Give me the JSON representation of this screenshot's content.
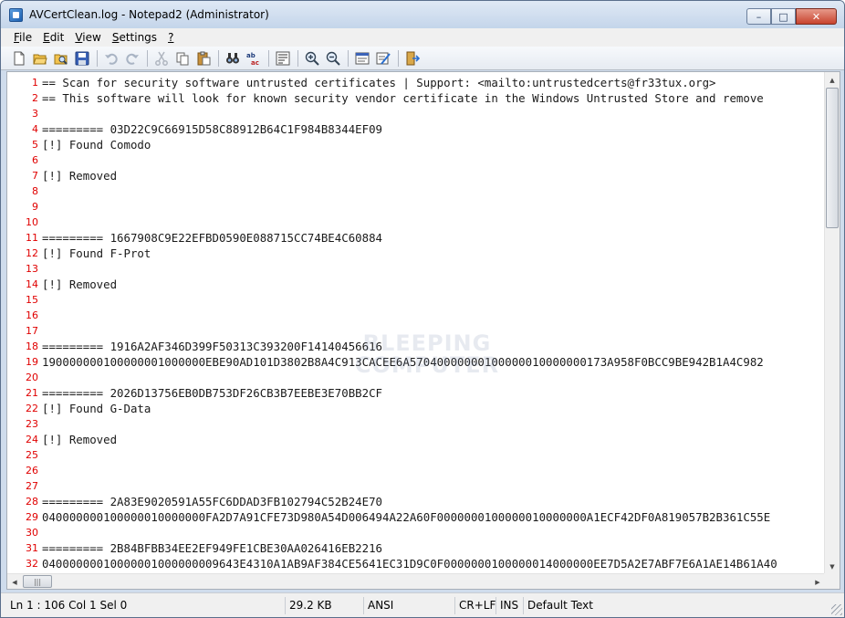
{
  "window": {
    "title": "AVCertClean.log - Notepad2 (Administrator)",
    "minimize_glyph": "–",
    "maximize_glyph": "□",
    "close_glyph": "✕"
  },
  "menu": {
    "file": {
      "accel": "F",
      "rest": "ile"
    },
    "edit": {
      "accel": "E",
      "rest": "dit"
    },
    "view": {
      "accel": "V",
      "rest": "iew"
    },
    "settings": {
      "accel": "S",
      "rest": "ettings"
    },
    "help": {
      "accel": "?",
      "rest": ""
    }
  },
  "toolbar_icons": [
    "new-file-icon",
    "open-folder-icon",
    "browse-icon",
    "save-icon",
    "undo-icon",
    "redo-icon",
    "cut-icon",
    "copy-icon",
    "paste-icon",
    "find-icon",
    "replace-icon",
    "word-wrap-icon",
    "zoom-in-icon",
    "zoom-out-icon",
    "schemes-icon",
    "customize-schemes-icon",
    "exit-icon"
  ],
  "watermark": {
    "line1": "BLEEPING",
    "line2": "COMPUTER"
  },
  "editor": {
    "lines": [
      {
        "n": "1",
        "text": "== Scan for security software untrusted certificates | Support: <mailto:untrustedcerts@fr33tux.org>"
      },
      {
        "n": "2",
        "text": "== This software will look for known security vendor certificate in the Windows Untrusted Store and remove"
      },
      {
        "n": "3",
        "text": ""
      },
      {
        "n": "4",
        "text": "========= 03D22C9C66915D58C88912B64C1F984B8344EF09"
      },
      {
        "n": "5",
        "text": "[!] Found Comodo"
      },
      {
        "n": "6",
        "text": ""
      },
      {
        "n": "7",
        "text": "[!] Removed"
      },
      {
        "n": "8",
        "text": ""
      },
      {
        "n": "9",
        "text": ""
      },
      {
        "n": "10",
        "text": ""
      },
      {
        "n": "11",
        "text": "========= 1667908C9E22EFBD0590E088715CC74BE4C60884"
      },
      {
        "n": "12",
        "text": "[!] Found F-Prot"
      },
      {
        "n": "13",
        "text": ""
      },
      {
        "n": "14",
        "text": "[!] Removed"
      },
      {
        "n": "15",
        "text": ""
      },
      {
        "n": "16",
        "text": ""
      },
      {
        "n": "17",
        "text": ""
      },
      {
        "n": "18",
        "text": "========= 1916A2AF346D399F50313C393200F14140456616"
      },
      {
        "n": "19",
        "text": "190000000100000001000000EBE90AD101D3802B8A4C913CACEE6A57040000000100000010000000173A958F0BCC9BE942B1A4C982"
      },
      {
        "n": "20",
        "text": ""
      },
      {
        "n": "21",
        "text": "========= 2026D13756EB0DB753DF26CB3B7EEBE3E70BB2CF"
      },
      {
        "n": "22",
        "text": "[!] Found G-Data"
      },
      {
        "n": "23",
        "text": ""
      },
      {
        "n": "24",
        "text": "[!] Removed"
      },
      {
        "n": "25",
        "text": ""
      },
      {
        "n": "26",
        "text": ""
      },
      {
        "n": "27",
        "text": ""
      },
      {
        "n": "28",
        "text": "========= 2A83E9020591A55FC6DDAD3FB102794C52B24E70"
      },
      {
        "n": "29",
        "text": "040000000100000010000000FA2D7A91CFE73D980A54D006494A22A60F0000000100000010000000A1ECF42DF0A819057B2B361C55E"
      },
      {
        "n": "30",
        "text": ""
      },
      {
        "n": "31",
        "text": "========= 2B84BFBB34EE2EF949FE1CBE30AA026416EB2216"
      },
      {
        "n": "32",
        "text": "04000000010000001000000009643E4310A1AB9AF384CE5641EC31D9C0F0000000100000014000000EE7D5A2E7ABF7E6A1AE14B61A40"
      }
    ]
  },
  "status": {
    "position": "Ln 1 : 106   Col 1   Sel 0",
    "size": "29.2 KB",
    "encoding": "ANSI",
    "eol": "CR+LF",
    "ovr": "INS",
    "scheme": "Default Text"
  }
}
